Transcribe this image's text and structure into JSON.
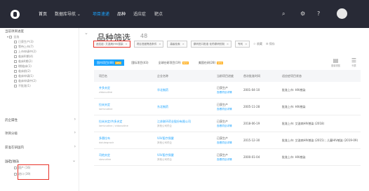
{
  "topbar": {
    "nav": [
      "首页",
      "数据库导航 ⌄",
      "项目速递",
      "品种",
      "适应症",
      "靶点"
    ],
    "icons": [
      "search-icon",
      "settings-icon",
      "help-icon",
      "user-icon"
    ]
  },
  "sidebar": {
    "title": "当前项目进度",
    "group_status": "全选",
    "status_items": [
      "已获生产(3)",
      "等待上市(7)",
      "上市申请中(2)",
      "临床III期(4)",
      "临床II期(2)",
      "I期临床(1)",
      "临床前(2)",
      "临床申请(1)",
      "临床申请中(2)",
      "不批准(1)"
    ],
    "sections": [
      "药企属性",
      "项目分级",
      "获准在研国内",
      "国产/进口"
    ],
    "import_group": "全选",
    "import_items": [
      "国产 (16)",
      "进口 (39)"
    ]
  },
  "main": {
    "title": "品种筛选",
    "count": "48",
    "filters": [
      "适应症: 艾滋病/HIV感染",
      "项目进度筛选条件",
      "高级检索",
      "原研进口批准 化药原研仿制",
      "专利"
    ],
    "filter_actions": [
      "✩ 收藏",
      "☰ 保存"
    ],
    "tabs": [
      {
        "label": "国内项目(48)",
        "active": true,
        "tag": "NEW"
      },
      {
        "label": "国际项目(43)",
        "active": false,
        "tag": ""
      },
      {
        "label": "全球在研项目(19)",
        "active": false,
        "tag": "NEW"
      },
      {
        "label": "美国在研(28)",
        "active": false,
        "tag": "NEW"
      }
    ],
    "view_icons": [
      "图谱视图",
      "列表"
    ],
    "columns": [
      "项目名",
      "企业名称",
      "当前项目进度",
      "首次批准时间",
      "适应症项目状态"
    ],
    "rows": [
      {
        "name": "齐多夫定",
        "name_sub": "zidovudine",
        "company": "华北制药",
        "company_sub": "",
        "status": "已获生产",
        "status2": "查看项目详情",
        "date": "2001-04-10",
        "note": "批准上市: HIV感染"
      },
      {
        "name": "拉米夫定",
        "name_sub": "lamivudine",
        "company": "东北制药",
        "company_sub": "",
        "status": "已获生产",
        "status2": "查看项目详情",
        "date": "2005-11-28",
        "note": "批准上市: HIV感染"
      },
      {
        "name": "拉米夫定/齐多夫定",
        "name_sub": "lamivudine / zidovudine",
        "company": "江苏联环药业股份有限公司",
        "company_sub": "其他公司药企",
        "status": "已获生产",
        "status2": "查看项目详情",
        "date": "2018-06-19",
        "note": "批准上市: 艾滋病HIV感染 (2018)"
      },
      {
        "name": "多替拉韦",
        "name_sub": "dolutegravir",
        "company": "ViiV医疗保健",
        "company_sub": "其他公司药企",
        "status": "已获生产",
        "status2": "查看项目详情",
        "date": "2015-12-30",
        "note": "批准上市: 艾滋病HIV感染 (2015) ; 儿童HIV感染 (2019-09)"
      },
      {
        "name": "司他夫定",
        "name_sub": "stavudine",
        "company": "ViiV医疗保健",
        "company_sub": "其他公司药企",
        "status": "已获生产",
        "status2": "查看项目详情",
        "date": "2000-01-04",
        "note": "批准上市: HIV感染"
      }
    ]
  }
}
